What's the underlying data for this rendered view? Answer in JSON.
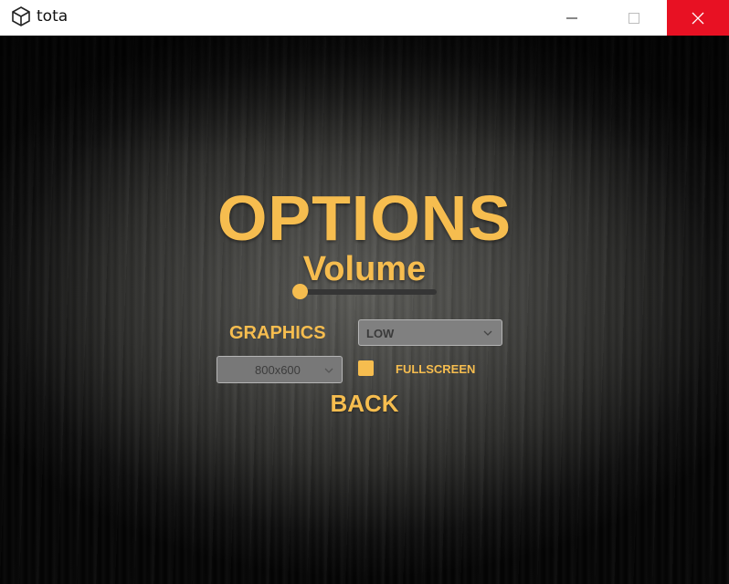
{
  "window": {
    "title": "tota",
    "icon": "unity-logo-icon",
    "controls": {
      "minimize_icon": "minimize-icon",
      "maximize_icon": "maximize-icon",
      "close_icon": "close-icon",
      "close_color": "#e81123"
    }
  },
  "menu": {
    "title": "OPTIONS",
    "volume": {
      "label": "Volume",
      "level": 0.0
    },
    "graphics": {
      "label": "GRAPHICS",
      "selected": "LOW"
    },
    "resolution": {
      "selected": "800x600"
    },
    "fullscreen": {
      "label": "FULLSCREEN",
      "checked": false
    },
    "back_label": "BACK",
    "accent_color": "#f6bd4f"
  }
}
